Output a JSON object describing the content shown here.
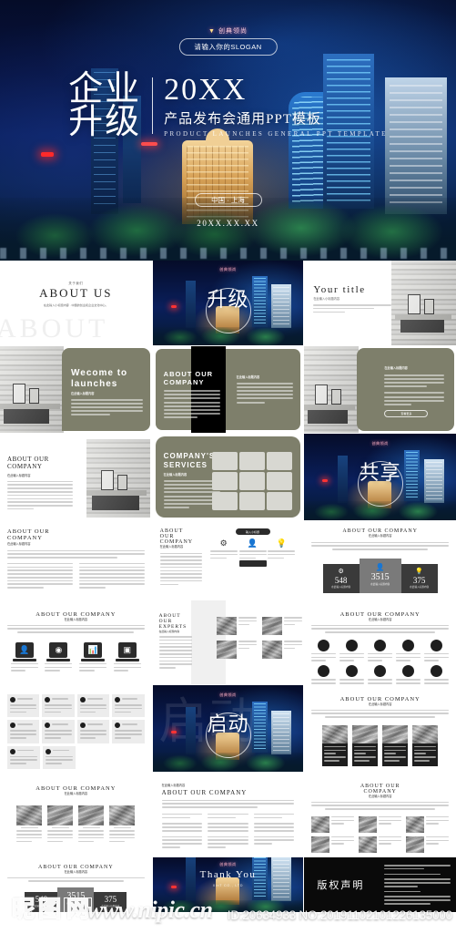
{
  "cover": {
    "brand": "创典领尚",
    "slogan": "请输入你的SLOGAN",
    "title_cn_1": "企业",
    "title_cn_2": "升级",
    "year": "20XX",
    "subtitle_cn": "产品发布会通用PPT模板",
    "subtitle_en": "PRODUCT LAUNCHES GENERAL PPT TEMPLATE",
    "place": "中国 · 上海",
    "date": "20XX.XX.XX"
  },
  "slides": {
    "about_us": {
      "kicker": "关于我们",
      "title": "ABOUT US",
      "desc": "在此输入小标题内容 · 中国的创业和企业文化中心。",
      "ghost": "ABOUT"
    },
    "section_upgrade": {
      "word": "升级"
    },
    "your_title": {
      "title": "Your title",
      "sub": "在此输入小标题内容",
      "body": "在此输入正文内容，在此输入正文内容，在此输入正文内容，在此输入正文内容。"
    },
    "welcome": {
      "title_l1": "Wecome to",
      "title_l2": "launches",
      "sub": "在此输入标题内容",
      "body": "在此输入正文内容，在此输入正文内容，在此输入正文内容，在此输入正文内容，在此输入正文内容。"
    },
    "about_company_dark": {
      "title_l1": "ABOUT OUR",
      "title_l2": "COMPANY",
      "sub": "在此输入标题内容",
      "body": "在此输入正文内容，在此输入正文内容，在此输入正文内容。"
    },
    "right_text_card": {
      "sub": "在此输入标题内容",
      "body": "在此输入正文内容，在此输入正文内容。",
      "button": "查看更多"
    },
    "about_company_light": {
      "title_l1": "ABOUT OUR",
      "title_l2": "COMPANY",
      "sub": "在此输入标题内容",
      "body": "在此输入正文内容，在此输入正文内容，在此输入正文内容。"
    },
    "services": {
      "title_l1": "COMPANY'S",
      "title_l2": "SERVICES",
      "sub": "在此输入标题内容",
      "body": "在此输入正文内容，在此输入正文内容，在此输入正文内容。",
      "tiles": 9
    },
    "section_share": {
      "word": "共享"
    },
    "two_column": {
      "title_l1": "ABOUT OUR",
      "title_l2": "COMPANY",
      "sub": "在此输入标题内容"
    },
    "experts_icons": {
      "title_l1": "ABOUT",
      "title_l2": "OUR",
      "title_l3": "COMPANY",
      "sub": "在此输入标题内容",
      "badge": "输入小标题"
    },
    "stats": {
      "title": "ABOUT OUR COMPANY",
      "sub": "在此输入标题内容",
      "items": [
        {
          "value": "548",
          "label": "在此输入标题内容"
        },
        {
          "value": "3515",
          "label": "在此输入标题内容"
        },
        {
          "value": "375",
          "label": "在此输入标题内容"
        }
      ]
    },
    "four_icons": {
      "title": "ABOUT OUR COMPANY",
      "sub": "在此输入标题内容",
      "count": 4
    },
    "experts_photos": {
      "title_l1": "ABOUT OUR",
      "title_l2": "EXPERTS",
      "sub": "在此输入标题内容"
    },
    "ten_icons": {
      "title": "ABOUT OUR COMPANY",
      "sub": "在此输入标题内容",
      "count": 10
    },
    "eight_cards": {
      "count": 8
    },
    "section_start": {
      "word": "启动"
    },
    "four_photos_dark": {
      "title": "ABOUT OUR COMPANY",
      "sub": "在此输入标题内容",
      "count": 4
    },
    "four_photos_light": {
      "title": "ABOUT OUR COMPANY",
      "sub": "在此输入标题内容",
      "count": 4
    },
    "three_col_text": {
      "kicker": "在此输入标题内容",
      "title": "ABOUT OUR COMPANY"
    },
    "six_photos": {
      "title_l1": "ABOUT OUR",
      "title_l2": "COMPANY",
      "sub": "在此输入标题内容",
      "count": 6
    },
    "stats_bottom": {
      "title": "ABOUT OUR COMPANY",
      "sub": "在此输入标题内容",
      "items": [
        {
          "value": "548",
          "label": "在此输入标题内容"
        },
        {
          "value": "3515",
          "label": "在此输入标题内容"
        },
        {
          "value": "375",
          "label": "在此输入标题内容"
        }
      ]
    },
    "thank_you": {
      "title": "Thank You",
      "sub": "XinT CO., LTD"
    },
    "copyright": {
      "title": "版权声明"
    }
  },
  "watermark": {
    "logo_chars": [
      "昵",
      "图",
      "网"
    ],
    "url": "www.nipic.cn",
    "id_no": "ID:20634933 NO:20191102101226135000"
  },
  "colors": {
    "olive": "#7e7f6b",
    "night": "#0a1f5c",
    "dark": "#2b2b2b"
  }
}
